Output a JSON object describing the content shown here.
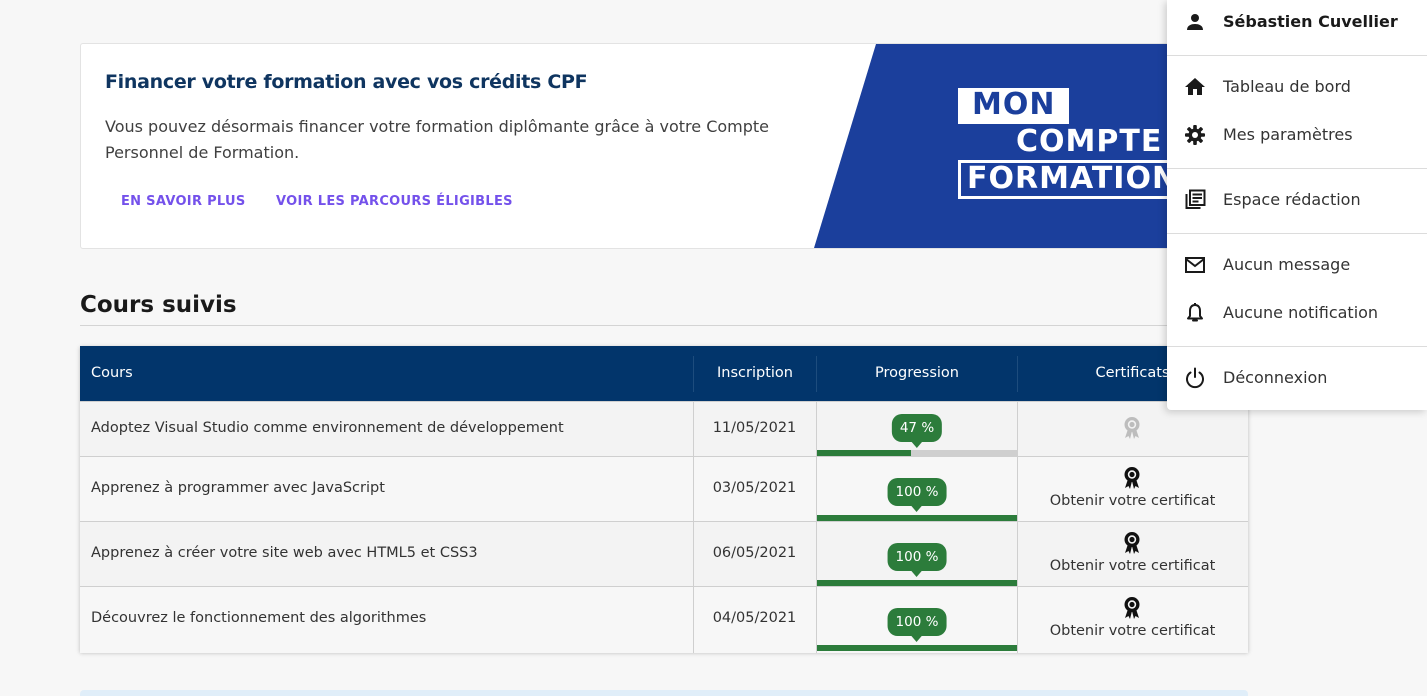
{
  "banner": {
    "title": "Financer votre formation avec vos crédits CPF",
    "text": "Vous pouvez désormais financer votre formation diplômante grâce à votre Compte Personnel de Formation.",
    "link1": "EN SAVOIR PLUS",
    "link2": "VOIR LES PARCOURS ÉLIGIBLES",
    "logo": {
      "line1": "MON",
      "line2": "COMPTE",
      "line3": "FORMATION"
    }
  },
  "section": {
    "title": "Cours suivis"
  },
  "table": {
    "headers": {
      "course": "Cours",
      "inscription": "Inscription",
      "progression": "Progression",
      "certificats": "Certificats"
    },
    "rows": [
      {
        "course": "Adoptez Visual Studio comme environnement de développement",
        "date": "11/05/2021",
        "progress_label": "47 %",
        "progress": 0.47,
        "certificate": ""
      },
      {
        "course": "Apprenez à programmer avec JavaScript",
        "date": "03/05/2021",
        "progress_label": "100 %",
        "progress": 1.0,
        "certificate": "Obtenir votre certificat"
      },
      {
        "course": "Apprenez à créer votre site web avec HTML5 et CSS3",
        "date": "06/05/2021",
        "progress_label": "100 %",
        "progress": 1.0,
        "certificate": "Obtenir votre certificat"
      },
      {
        "course": "Découvrez le fonctionnement des algorithmes",
        "date": "04/05/2021",
        "progress_label": "100 %",
        "progress": 1.0,
        "certificate": "Obtenir votre certificat"
      }
    ]
  },
  "menu": {
    "user": "Sébastien Cuvellier",
    "dashboard": "Tableau de bord",
    "settings": "Mes paramètres",
    "editorial": "Espace rédaction",
    "messages": "Aucun message",
    "notifications": "Aucune notification",
    "logout": "Déconnexion"
  },
  "colors": {
    "navy": "#02356b",
    "green": "#2c7c3b",
    "link_purple": "#7451eb",
    "cpf_blue": "#1b3f9c"
  },
  "icons": [
    "person-icon",
    "home-icon",
    "gear-icon",
    "newspaper-icon",
    "mail-icon",
    "bell-icon",
    "power-icon",
    "award-ribbon-icon"
  ]
}
